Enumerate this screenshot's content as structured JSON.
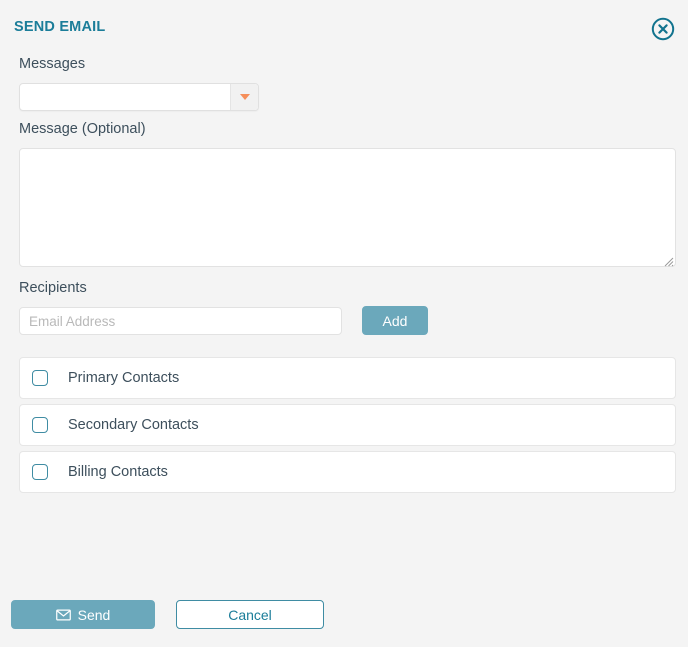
{
  "dialog": {
    "title": "SEND EMAIL",
    "close_icon": "close-circle-icon"
  },
  "messages_field": {
    "label": "Messages",
    "selected_value": "",
    "dropdown_icon": "chevron-down-icon",
    "dropdown_icon_color": "#f58e5a"
  },
  "message_field": {
    "label": "Message (Optional)",
    "value": "",
    "placeholder": "",
    "resize_handle_icon": "resize-grip-icon"
  },
  "recipients": {
    "label": "Recipients",
    "email_input_value": "",
    "email_input_placeholder": "Email Address",
    "add_label": "Add",
    "groups": [
      {
        "label": "Primary Contacts",
        "checked": false
      },
      {
        "label": "Secondary Contacts",
        "checked": false
      },
      {
        "label": "Billing Contacts",
        "checked": false
      }
    ]
  },
  "footer": {
    "send_label": "Send",
    "send_icon": "envelope-icon",
    "cancel_label": "Cancel"
  },
  "theme": {
    "title_color": "#1b7d99",
    "accent_teal": "#6ba8bb",
    "outline_teal": "#3f8ca3",
    "label_color": "#3d4f5c",
    "background": "#f4f4f4",
    "orange": "#f58e5a"
  }
}
